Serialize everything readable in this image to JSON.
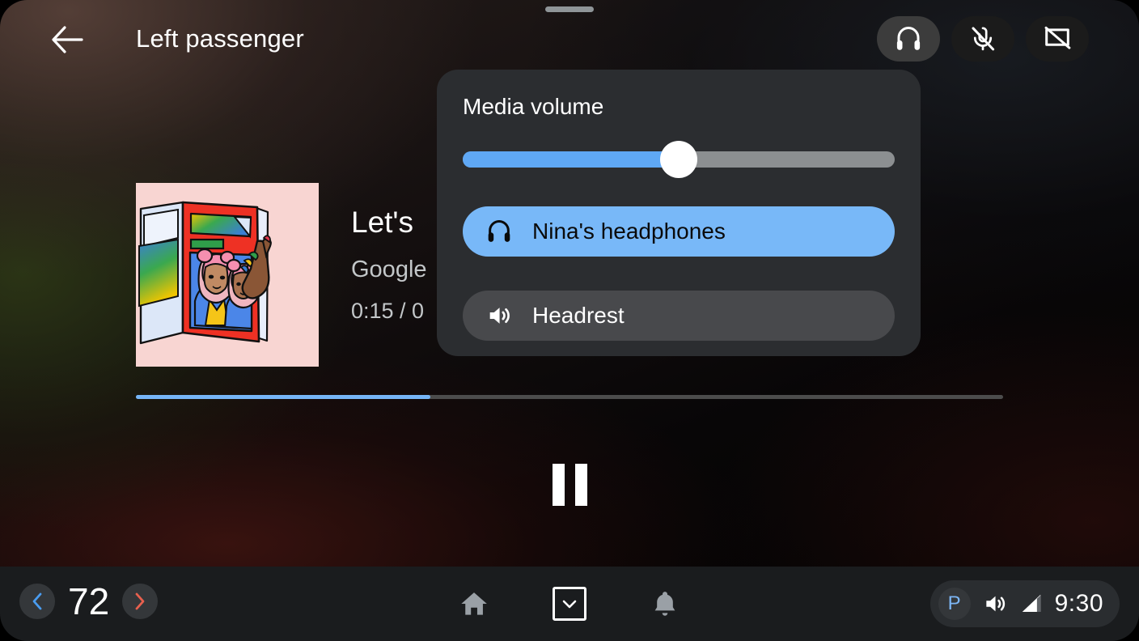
{
  "window": {
    "title": "Left passenger",
    "drag_handle": "drag-handle"
  },
  "topbar": {
    "back_label": "back-arrow",
    "actions": [
      {
        "name": "headphones",
        "label": "Headphones output",
        "active": true
      },
      {
        "name": "mic-off",
        "label": "Microphone muted",
        "active": false
      },
      {
        "name": "screen-off",
        "label": "Screen off",
        "active": false
      }
    ]
  },
  "now_playing": {
    "title": "Let's",
    "artist": "Google",
    "time": "0:15 / 0",
    "progress_percent": 34,
    "transport": "pause",
    "album_art_alt": "Illustration of two women with pink hair in blue jackets on a red magazine cover held by a hand, pink background"
  },
  "popover": {
    "title": "Media volume",
    "volume_percent": 50,
    "devices": [
      {
        "icon": "headphones-icon",
        "label": "Nina's headphones",
        "selected": true
      },
      {
        "icon": "speaker-icon",
        "label": "Headrest",
        "selected": false
      }
    ]
  },
  "sysbar": {
    "temperature": "72",
    "temp_down_icon": "chevron-left-icon",
    "temp_up_icon": "chevron-right-icon",
    "nav": [
      {
        "name": "home",
        "label": "Home"
      },
      {
        "name": "app-drawer",
        "label": "App drawer"
      },
      {
        "name": "notifications",
        "label": "Notifications"
      }
    ],
    "gear": "P",
    "volume_icon": "volume-icon",
    "signal_icon": "signal-icon",
    "clock": "9:30"
  },
  "colors": {
    "accent_blue": "#78b8f8",
    "slider_blue": "#5fa8f5",
    "progress_blue": "#76b5f7",
    "panel": "#2b2d30",
    "sysbar": "#1a1c1e",
    "cool_chevron": "#4a9cf0",
    "warm_chevron": "#e8604e",
    "gear_blue": "#7cb6f5"
  }
}
